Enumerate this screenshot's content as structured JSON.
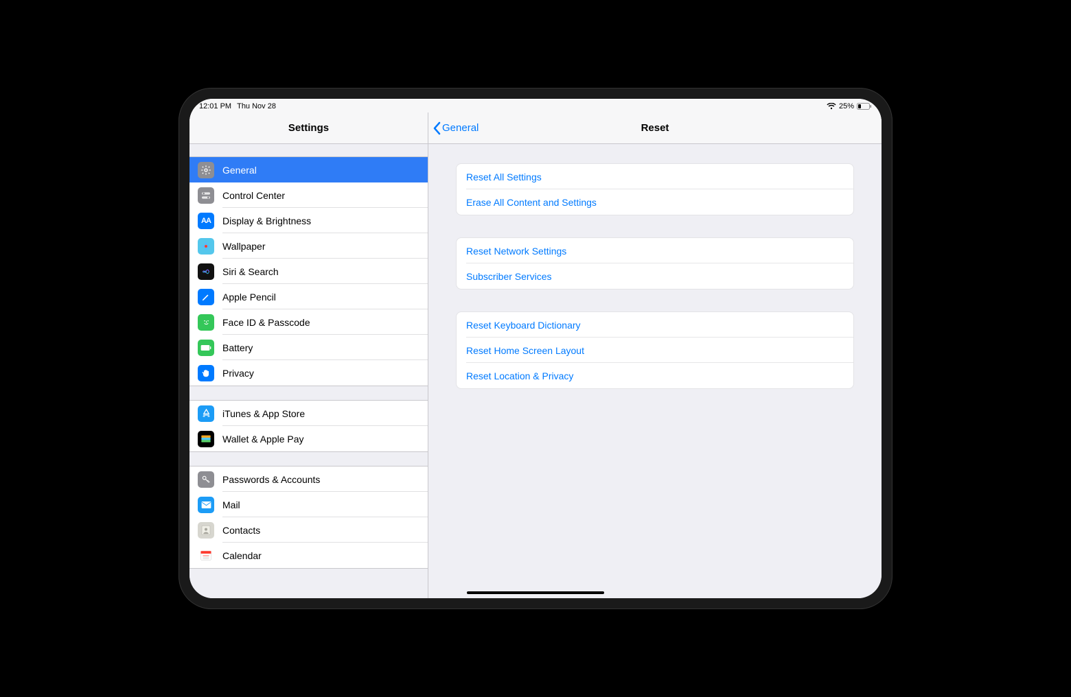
{
  "status": {
    "time": "12:01 PM",
    "date": "Thu Nov 28",
    "battery_pct": "25%"
  },
  "sidebar": {
    "title": "Settings",
    "groups": [
      [
        {
          "id": "general",
          "label": "General",
          "selected": true,
          "icon": "gear",
          "bg": "#8e8e93"
        },
        {
          "id": "control-center",
          "label": "Control Center",
          "icon": "switches",
          "bg": "#8e8e93"
        },
        {
          "id": "display",
          "label": "Display & Brightness",
          "icon": "aa",
          "bg": "#007aff"
        },
        {
          "id": "wallpaper",
          "label": "Wallpaper",
          "icon": "flower",
          "bg": "#54c7ec"
        },
        {
          "id": "siri",
          "label": "Siri & Search",
          "icon": "siri",
          "bg": "#111"
        },
        {
          "id": "pencil",
          "label": "Apple Pencil",
          "icon": "pencil",
          "bg": "#007aff"
        },
        {
          "id": "faceid",
          "label": "Face ID & Passcode",
          "icon": "face",
          "bg": "#34c759"
        },
        {
          "id": "battery",
          "label": "Battery",
          "icon": "battery",
          "bg": "#34c759"
        },
        {
          "id": "privacy",
          "label": "Privacy",
          "icon": "hand",
          "bg": "#007aff"
        }
      ],
      [
        {
          "id": "itunes",
          "label": "iTunes & App Store",
          "icon": "appstore",
          "bg": "#1c9cf6"
        },
        {
          "id": "wallet",
          "label": "Wallet & Apple Pay",
          "icon": "wallet",
          "bg": "#000"
        }
      ],
      [
        {
          "id": "passwords",
          "label": "Passwords & Accounts",
          "icon": "key",
          "bg": "#8e8e93"
        },
        {
          "id": "mail",
          "label": "Mail",
          "icon": "mail",
          "bg": "#1c9cf6"
        },
        {
          "id": "contacts",
          "label": "Contacts",
          "icon": "contacts",
          "bg": "#d7d6cf"
        },
        {
          "id": "calendar",
          "label": "Calendar",
          "icon": "calendar",
          "bg": "#fff"
        }
      ]
    ]
  },
  "detail": {
    "back_label": "General",
    "title": "Reset",
    "groups": [
      [
        "Reset All Settings",
        "Erase All Content and Settings"
      ],
      [
        "Reset Network Settings",
        "Subscriber Services"
      ],
      [
        "Reset Keyboard Dictionary",
        "Reset Home Screen Layout",
        "Reset Location & Privacy"
      ]
    ]
  }
}
